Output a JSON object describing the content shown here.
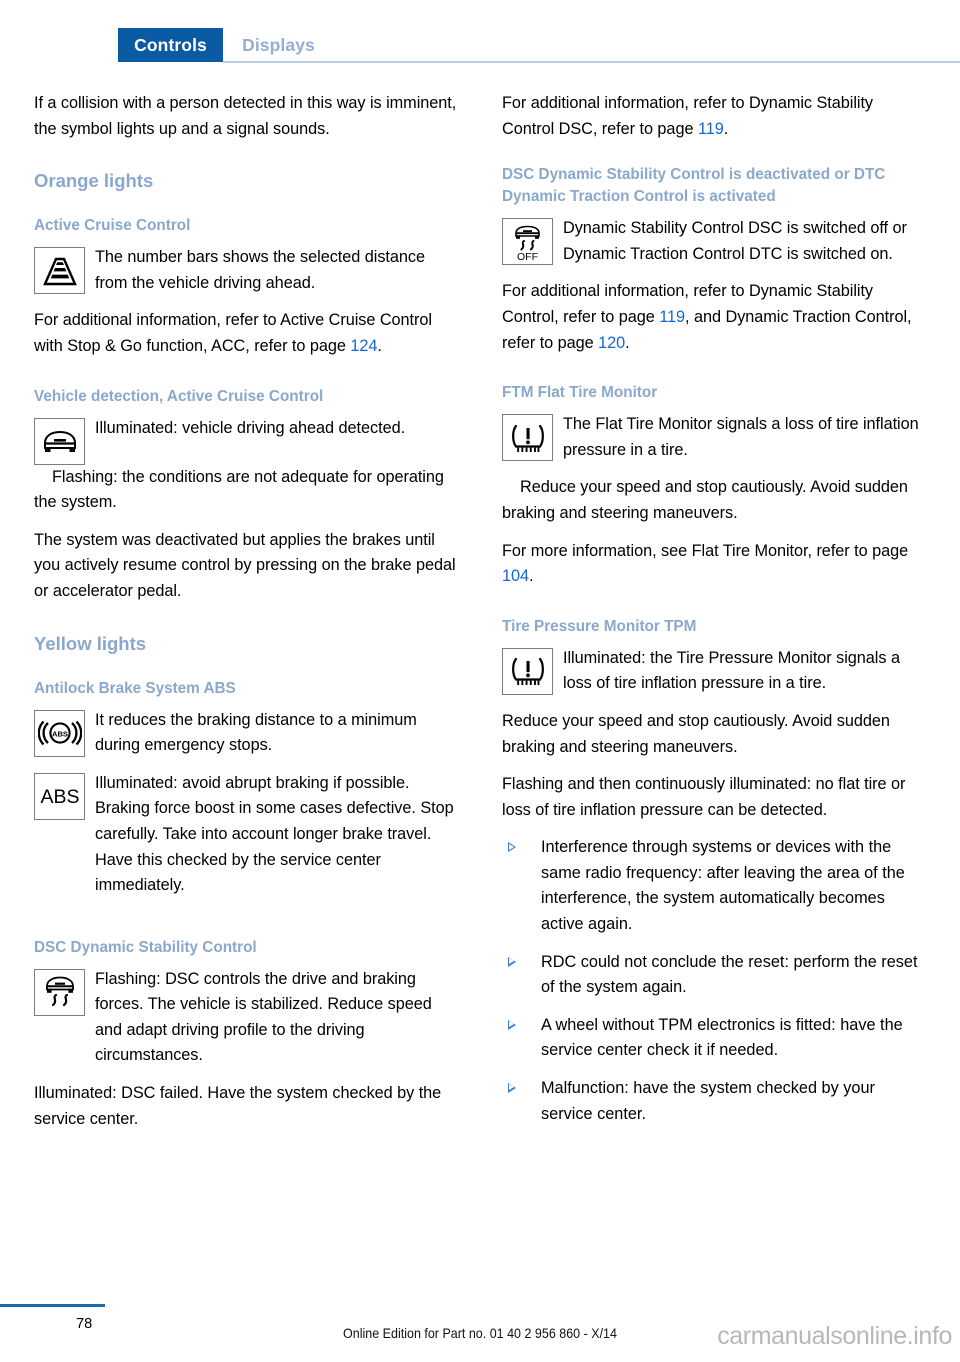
{
  "tabs": [
    {
      "label": "Controls",
      "active": true
    },
    {
      "label": "Displays",
      "active": false
    }
  ],
  "colors": {
    "tab_active_bg": "#0b5ba4",
    "tab_inactive_text": "#93afd2",
    "heading": "#8aa8cc",
    "page_link": "#1667d6",
    "bullet": "#3f7fd0",
    "footer_rule": "#1d69ad"
  },
  "left_column": {
    "intro": "If a collision with a person detected in this way is imminent, the symbol lights up and a signal sounds.",
    "orange_lights_heading": "Orange lights",
    "active_cruise_control": {
      "heading": "Active Cruise Control",
      "icon": "distance-bars-icon",
      "text": "The number bars shows the selected distance from the vehicle driving ahead.",
      "more_info_pre": "For additional information, refer to Active Cruise Control with Stop & Go function, ACC, refer to page ",
      "more_info_page": "124",
      "more_info_post": "."
    },
    "vehicle_detection": {
      "heading": "Vehicle detection, Active Cruise Control",
      "icon": "car-front-icon",
      "illuminated": "Illuminated: vehicle driving ahead detected.",
      "flashing": "Flashing: the conditions are not adequate for operating the system.",
      "system": "The system was deactivated but applies the brakes until you actively resume control by pressing on the brake pedal or accelerator pedal."
    },
    "yellow_lights_heading": "Yellow lights",
    "abs": {
      "heading": "Antilock Brake System ABS",
      "icon1": "abs-ring-icon",
      "icon2": "abs-text-icon",
      "text1": "It reduces the braking distance to a minimum during emergency stops.",
      "text2": "Illuminated: avoid abrupt braking if possible. Braking force boost in some cases defective. Stop carefully. Take into account longer brake travel. Have this checked by the service center immediately."
    },
    "dsc": {
      "heading": "DSC Dynamic Stability Control",
      "icon": "dsc-car-skid-icon",
      "flashing": "Flashing: DSC controls the drive and braking forces. The vehicle is stabilized. Reduce speed and adapt driving profile to the driving circumstances.",
      "illuminated": "Illuminated: DSC failed. Have the system checked by the service center."
    }
  },
  "right_column": {
    "dsc_info_pre": "For additional information, refer to Dynamic Stability Control DSC, refer to page ",
    "dsc_info_page": "119",
    "dsc_info_post": ".",
    "dsc_off": {
      "heading": "DSC Dynamic Stability Control is deactivated or DTC Dynamic Traction Control is activated",
      "icon": "dsc-off-icon",
      "text": "Dynamic Stability Control DSC is switched off or Dynamic Traction Control DTC is switched on.",
      "more_info_pre": "For additional information, refer to Dynamic Stability Control, refer to page ",
      "more_info_page1": "119",
      "more_info_mid": ", and Dynamic Traction Control, refer to page ",
      "more_info_page2": "120",
      "more_info_post": "."
    },
    "ftm": {
      "heading": "FTM Flat Tire Monitor",
      "icon": "tire-pressure-warning-icon",
      "text1": "The Flat Tire Monitor signals a loss of tire inflation pressure in a tire.",
      "text2": "Reduce your speed and stop cautiously. Avoid sudden braking and steering maneuvers.",
      "more_info_pre": "For more information, see Flat Tire Monitor, refer to page ",
      "more_info_page": "104",
      "more_info_post": "."
    },
    "tpm": {
      "heading": "Tire Pressure Monitor TPM",
      "icon": "tire-pressure-warning-icon",
      "text1": "Illuminated: the Tire Pressure Monitor signals a loss of tire inflation pressure in a tire.",
      "text2": "Reduce your speed and stop cautiously. Avoid sudden braking and steering maneuvers.",
      "text3": "Flashing and then continuously illuminated: no flat tire or loss of tire inflation pressure can be detected.",
      "bullets": [
        "Interference through systems or devices with the same radio frequency: after leaving the area of the interference, the system automatically becomes active again.",
        "RDC could not conclude the reset: perform the reset of the system again.",
        "A wheel without TPM electronics is fitted: have the service center check it if needed.",
        "Malfunction: have the system checked by your service center."
      ]
    }
  },
  "footer": {
    "page_number": "78",
    "edition": "Online Edition for Part no. 01 40 2 956 860 - X/14",
    "watermark": "carmanualsonline.info"
  }
}
